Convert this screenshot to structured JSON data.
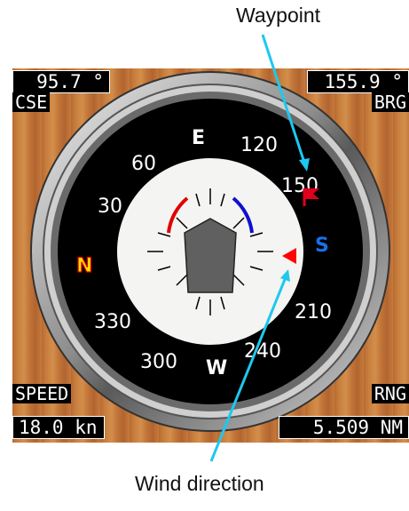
{
  "callouts": {
    "waypoint": "Waypoint",
    "wind_direction": "Wind direction"
  },
  "readouts": {
    "course": {
      "value": "95.7 °",
      "label": "CSE"
    },
    "bearing": {
      "value": "155.9 °",
      "label": "BRG"
    },
    "speed": {
      "value": "18.0 kn",
      "label": "SPEED"
    },
    "range": {
      "value": "5.509 NM",
      "label": "RNG"
    }
  },
  "compass": {
    "cardinals": {
      "north": "N",
      "east": "E",
      "south": "S",
      "west": "W"
    },
    "degree_labels": [
      "30",
      "60",
      "120",
      "150",
      "210",
      "240",
      "300",
      "330"
    ]
  },
  "colors": {
    "waypoint_flag": "#e0001c",
    "wind_marker": "#ff0000",
    "callout_line": "#1ec8ee",
    "north_fill": "#ffe600",
    "north_outline": "#e00000",
    "south": "#1a6fe8",
    "port_arc": "#e00000",
    "starboard_arc": "#1010d0"
  },
  "icons": {
    "waypoint": "flag-icon",
    "wind": "triangle-pointer-icon",
    "vessel": "boat-icon"
  }
}
